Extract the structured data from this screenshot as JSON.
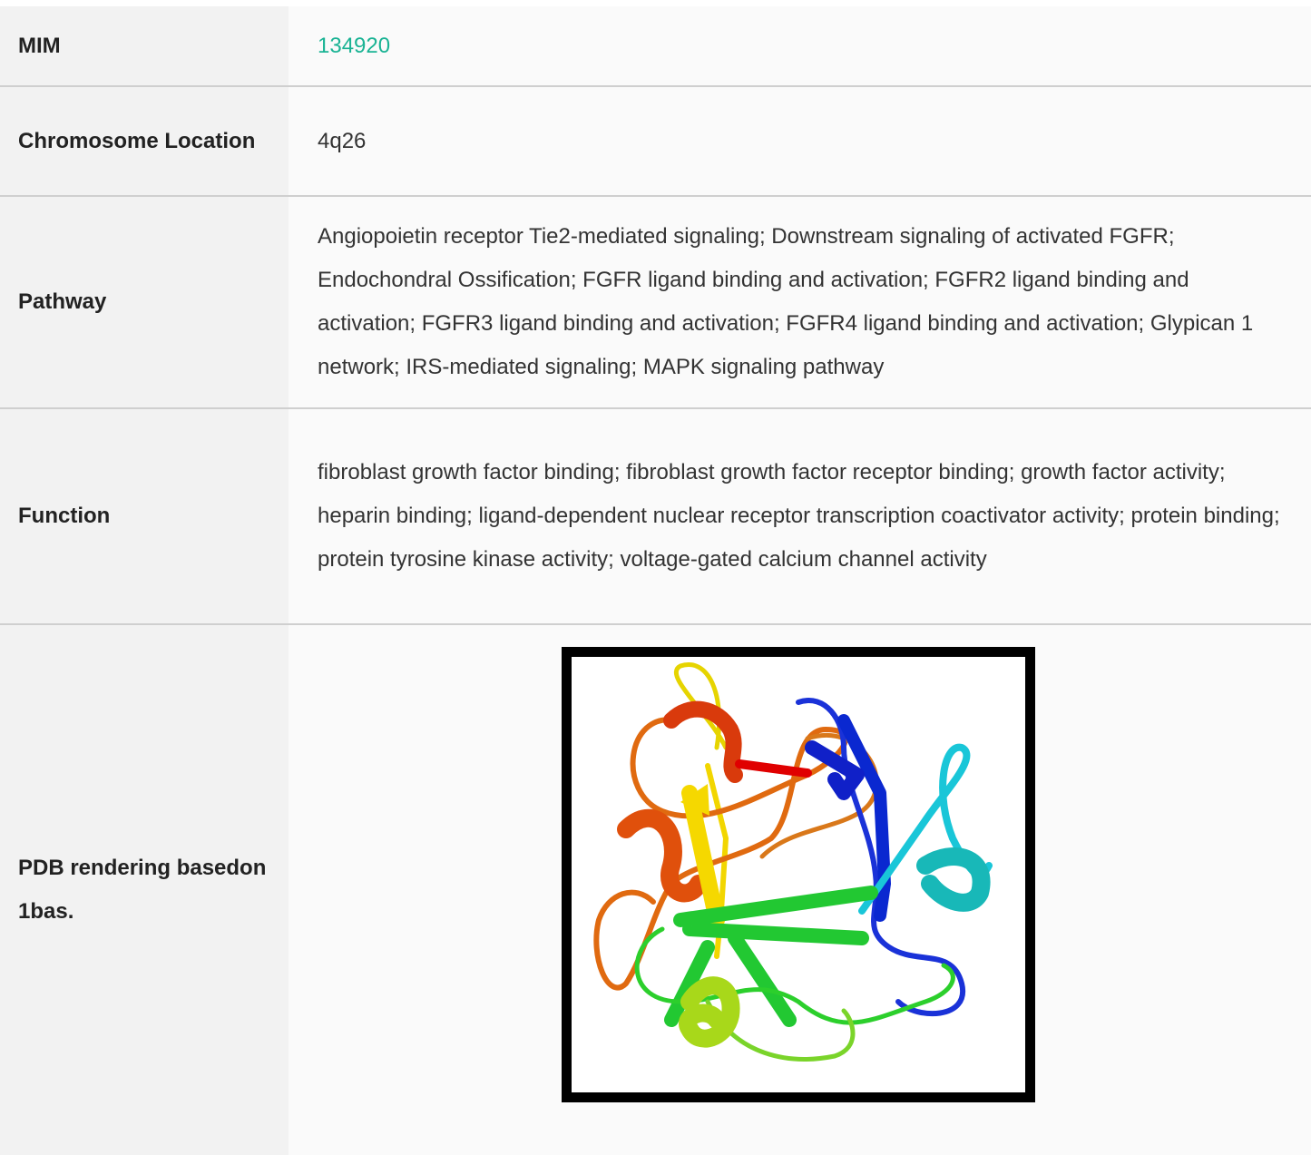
{
  "rows": [
    {
      "label": "MIM",
      "value": "134920"
    },
    {
      "label": "Chromosome Location",
      "value": "4q26"
    },
    {
      "label": "Pathway",
      "value": "Angiopoietin receptor Tie2-mediated signaling; Downstream signaling of activated FGFR; Endochondral Ossification; FGFR ligand binding and activation; FGFR2 ligand binding and activation; FGFR3 ligand binding and activation; FGFR4 ligand binding and activation; Glypican 1 network; IRS-mediated signaling; MAPK signaling pathway"
    },
    {
      "label": "Function",
      "value": "fibroblast growth factor binding; fibroblast growth factor receptor binding; growth factor activity; heparin binding; ligand-dependent nuclear receptor transcription coactivator activity; protein binding; protein tyrosine kinase activity; voltage-gated calcium channel activity"
    },
    {
      "label": "PDB rendering basedon 1bas."
    }
  ],
  "colors": {
    "link": "#1ab394",
    "label_bg": "#f2f2f2",
    "value_bg": "#fafafa",
    "divider": "#cfcfcf"
  },
  "image": {
    "icon": "protein-ribbon-structure"
  }
}
